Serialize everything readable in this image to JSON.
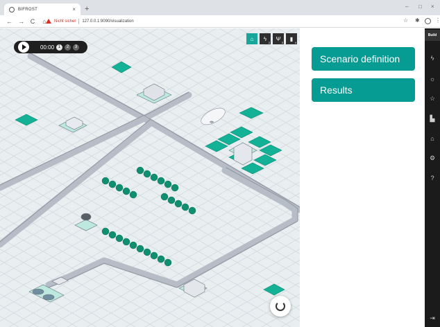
{
  "browser": {
    "tab_title": "BIFROST",
    "tab_close": "×",
    "new_tab": "+",
    "window_controls": [
      "–",
      "□",
      "×"
    ],
    "nav": {
      "back": "←",
      "forward": "→",
      "reload": "C",
      "home": "⌂"
    },
    "security_label": "Nicht sicher",
    "url": "127.0.0.1:9090/visualization",
    "star": "☆",
    "extensions": "✱",
    "menu": "⋮"
  },
  "player": {
    "time": "00:00",
    "speeds": [
      "1",
      "2",
      "3"
    ]
  },
  "layers": [
    {
      "icon": "⌂",
      "sub": ""
    },
    {
      "icon": "ϟ",
      "sub": "2"
    },
    {
      "icon": "Ψ",
      "sub": "3"
    },
    {
      "icon": "▮",
      "sub": "4"
    }
  ],
  "panel": {
    "scenario_label": "Scenario definition",
    "results_label": "Results"
  },
  "sidenav": {
    "build_label": "Build",
    "icons": [
      "ϟ",
      "☼",
      "☆",
      "▙",
      "⌂",
      "⚙",
      "?"
    ],
    "logout": "⇥"
  },
  "colors": {
    "accent": "#069c93",
    "map_background": "#e9eff1",
    "sidenav": "#1b1b1b"
  }
}
